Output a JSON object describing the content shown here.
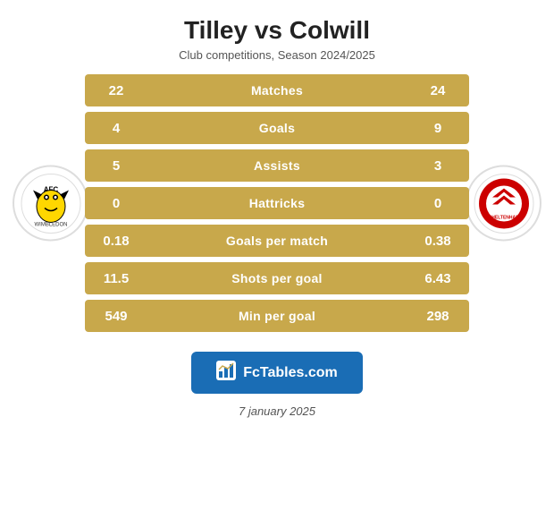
{
  "header": {
    "title": "Tilley vs Colwill",
    "subtitle": "Club competitions, Season 2024/2025"
  },
  "stats": [
    {
      "label": "Matches",
      "left": "22",
      "right": "24"
    },
    {
      "label": "Goals",
      "left": "4",
      "right": "9"
    },
    {
      "label": "Assists",
      "left": "5",
      "right": "3"
    },
    {
      "label": "Hattricks",
      "left": "0",
      "right": "0"
    },
    {
      "label": "Goals per match",
      "left": "0.18",
      "right": "0.38"
    },
    {
      "label": "Shots per goal",
      "left": "11.5",
      "right": "6.43"
    },
    {
      "label": "Min per goal",
      "left": "549",
      "right": "298"
    }
  ],
  "branding": {
    "logo_text": "FcTables.com"
  },
  "footer": {
    "date": "7 january 2025"
  },
  "colors": {
    "gold": "#c8a84b",
    "blue": "#1a6db5",
    "cap_gray": "#aaa"
  }
}
